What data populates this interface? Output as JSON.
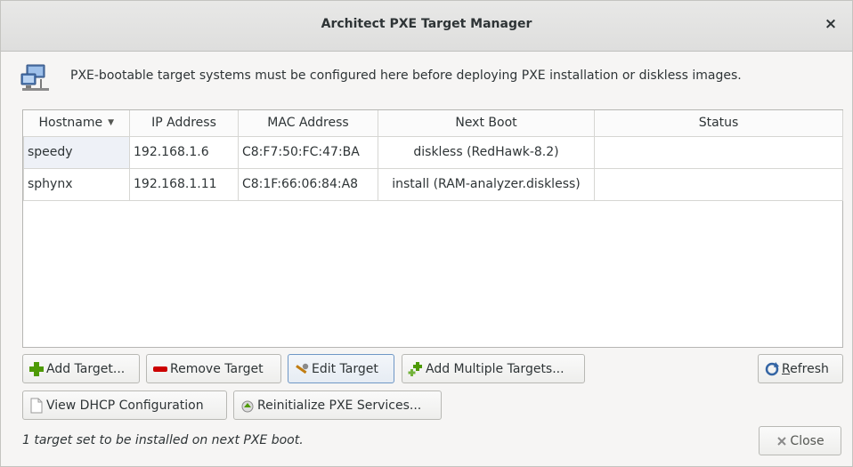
{
  "window": {
    "title": "Architect PXE Target Manager",
    "close_glyph": "×"
  },
  "info": {
    "icon": "computer-network-icon",
    "text": "PXE-bootable target systems must be configured here before deploying PXE installation or diskless images."
  },
  "table": {
    "columns": [
      "Hostname",
      "IP Address",
      "MAC Address",
      "Next Boot",
      "Status"
    ],
    "sort_glyph": "▼",
    "rows": [
      {
        "hostname": "speedy",
        "ip": "192.168.1.6",
        "mac": "C8:F7:50:FC:47:BA",
        "next_boot": "diskless (RedHawk-8.2)",
        "status": ""
      },
      {
        "hostname": "sphynx",
        "ip": "192.168.1.11",
        "mac": "C8:1F:66:06:84:A8",
        "next_boot": "install (RAM-analyzer.diskless)",
        "status": ""
      }
    ]
  },
  "buttons": {
    "add_target": "Add Target...",
    "remove_target": "Remove Target",
    "edit_target": "Edit Target",
    "add_multiple": "Add Multiple Targets...",
    "refresh_prefix": "R",
    "refresh_rest": "efresh",
    "view_dhcp": "View DHCP Configuration",
    "reinit_pxe": "Reinitialize PXE Services...",
    "close": "Close"
  },
  "status_text": "1 target set to be installed on next PXE boot.",
  "colors": {
    "add_green": "#4e9a06",
    "remove_red": "#cc0000",
    "focus_blue": "#6f97c6"
  }
}
